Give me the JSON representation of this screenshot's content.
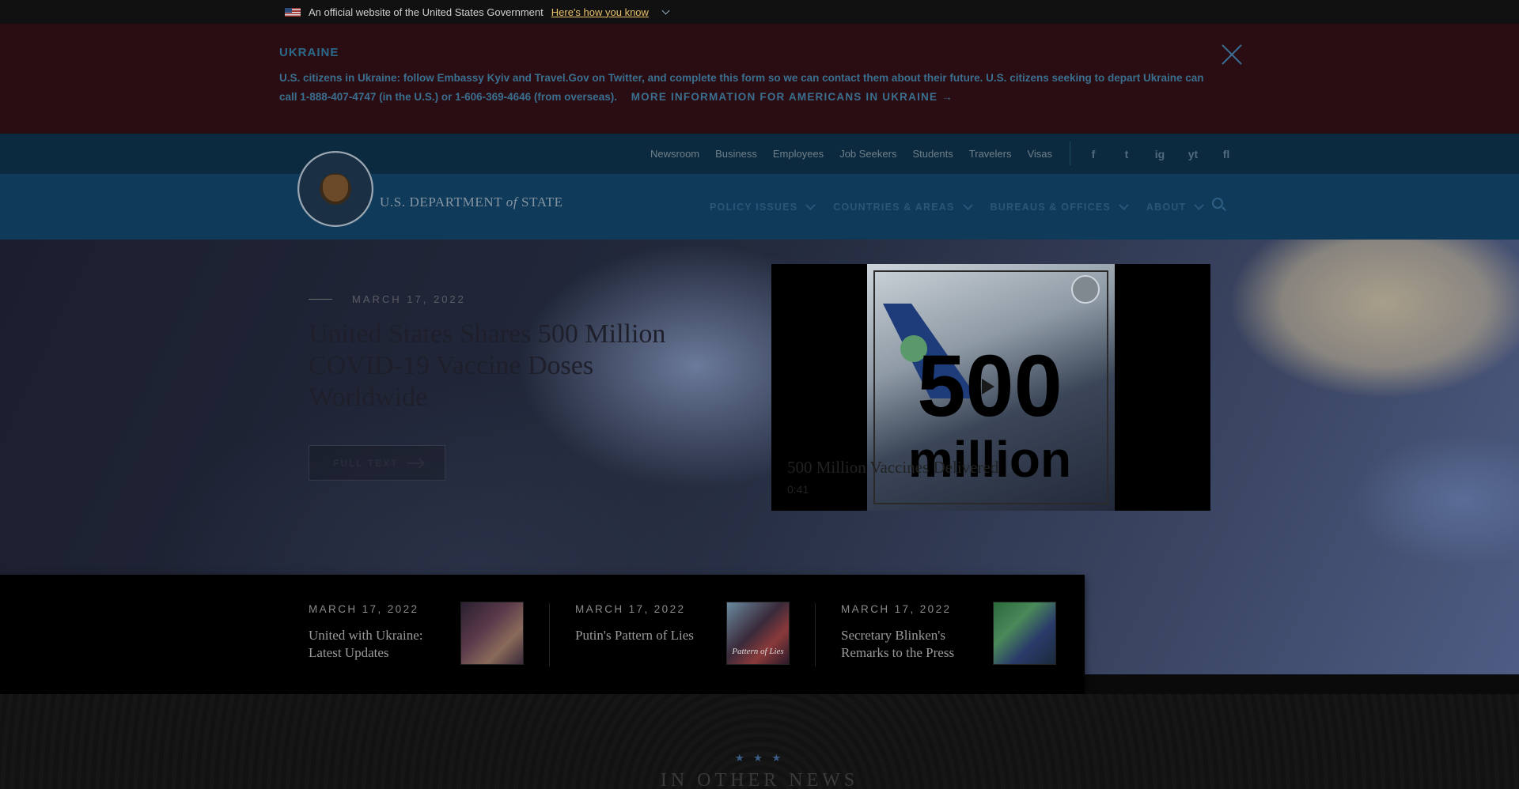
{
  "gov_banner": {
    "text": "An official website of the United States Government",
    "link": "Here's how you know"
  },
  "alert": {
    "title": "UKRAINE",
    "text": "U.S. citizens in Ukraine: follow Embassy Kyiv and Travel.Gov on Twitter, and complete this form so we can contact them about their future. U.S. citizens seeking to depart Ukraine can call 1-888-407-4747 (in the U.S.) or 1-606-369-4646 (from overseas).",
    "more": "MORE INFORMATION FOR AMERICANS IN UKRAINE →"
  },
  "utility_nav": [
    "Newsroom",
    "Business",
    "Employees",
    "Job Seekers",
    "Students",
    "Travelers",
    "Visas"
  ],
  "social": [
    "f",
    "t",
    "ig",
    "yt",
    "fl"
  ],
  "brand": {
    "prefix": "U.S. DEPARTMENT",
    "of": "of",
    "suffix": "STATE"
  },
  "main_nav": [
    "POLICY ISSUES",
    "COUNTRIES & AREAS",
    "BUREAUS & OFFICES",
    "ABOUT"
  ],
  "hero": {
    "date": "MARCH 17, 2022",
    "title": "United States Shares 500 Million COVID-19 Vaccine Doses Worldwide",
    "button": "FULL TEXT"
  },
  "video": {
    "overlay_number": "500",
    "overlay_word": "million",
    "caption": "500 Million Vaccines Delivered",
    "duration": "0:41"
  },
  "featured": [
    {
      "date": "MARCH 17, 2022",
      "title": "United with Ukraine: Latest Updates"
    },
    {
      "date": "MARCH 17, 2022",
      "title": "Putin's Pattern of Lies"
    },
    {
      "date": "MARCH 17, 2022",
      "title": "Secretary Blinken's Remarks to the Press"
    }
  ],
  "thumb_text": "Pattern of Lies",
  "other_news": {
    "stars": "★ ★ ★",
    "title": "IN OTHER NEWS"
  }
}
